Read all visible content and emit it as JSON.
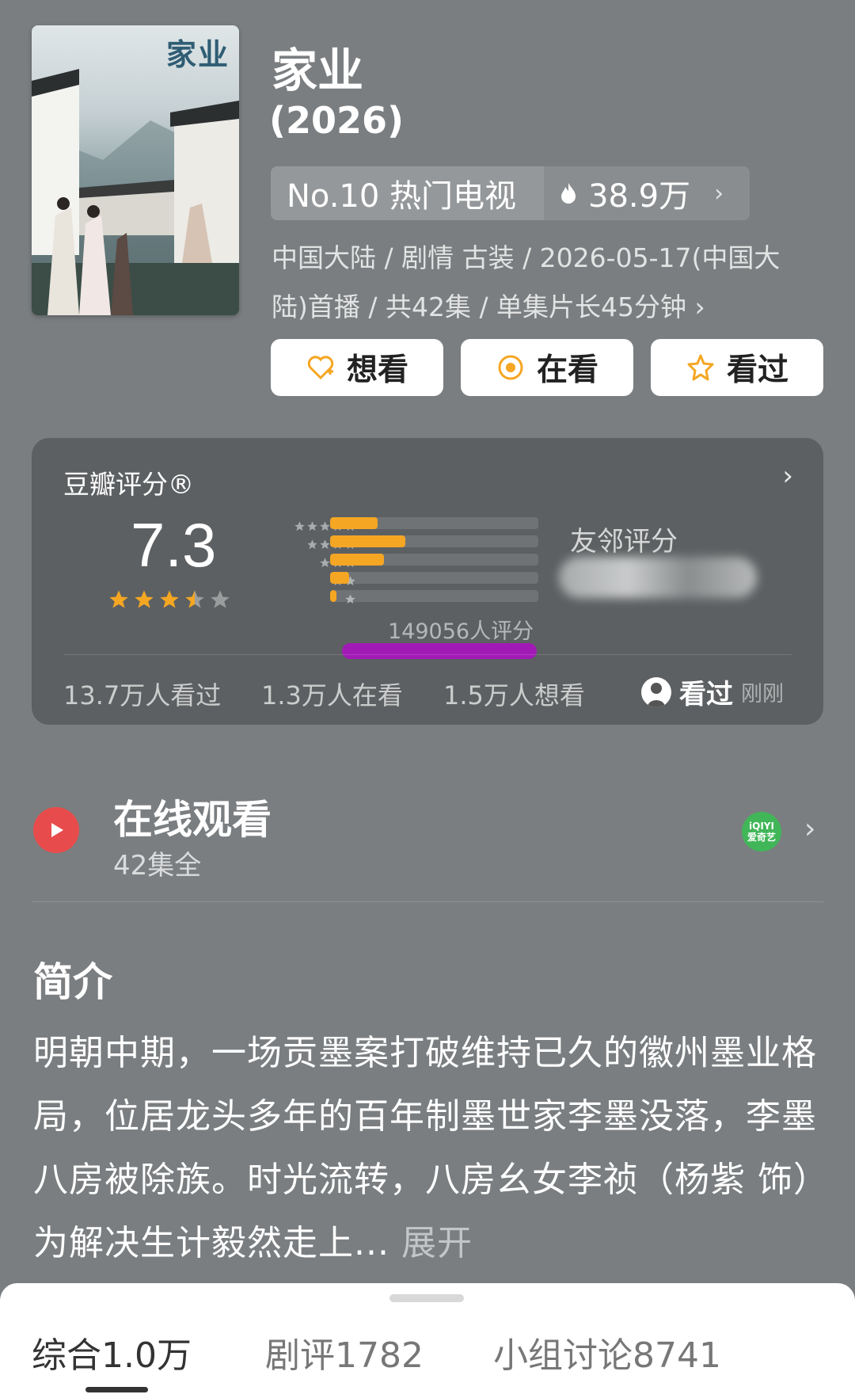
{
  "poster": {
    "title": "家业"
  },
  "header": {
    "title": "家业",
    "year": "(2026)",
    "rank_label": "No.10 热门电视",
    "heat_value": "38.9万",
    "meta_line1": "中国大陆 / 剧情 古装 / 2026-05-17(中国大",
    "meta_line2": "陆)首播 / 共42集 / 单集片长45分钟 ›"
  },
  "actions": [
    {
      "label": "想看",
      "icon": "heart-plus-icon"
    },
    {
      "label": "在看",
      "icon": "target-icon"
    },
    {
      "label": "看过",
      "icon": "star-outline-icon"
    }
  ],
  "rating": {
    "label": "豆瓣评分®",
    "score": "7.3",
    "stars": 3.5,
    "distribution": [
      {
        "stars": 5,
        "fraction": 0.23
      },
      {
        "stars": 4,
        "fraction": 0.36
      },
      {
        "stars": 3,
        "fraction": 0.26
      },
      {
        "stars": 2,
        "fraction": 0.09
      },
      {
        "stars": 1,
        "fraction": 0.03
      }
    ],
    "count_text": "149056人评分",
    "friend_label": "友邻评分",
    "stats": [
      "13.7万人看过",
      "1.3万人在看",
      "1.5万人想看"
    ],
    "my_status": "看过",
    "my_status_time": "刚刚"
  },
  "watch": {
    "title": "在线观看",
    "subtitle": "42集全",
    "provider_label_1": "iQIYI",
    "provider_label_2": "爱奇艺"
  },
  "intro": {
    "heading": "简介",
    "text": "明朝中期，一场贡墨案打破维持已久的徽州墨业格局，位居龙头多年的百年制墨世家李墨没落，李墨八房被除族。时光流转，八房幺女李祯（杨紫 饰）为解决生计毅然走上... ",
    "expand_label": "展开"
  },
  "tabs": [
    {
      "label": "综合",
      "count": "1.0万"
    },
    {
      "label": "剧评",
      "count": "1782"
    },
    {
      "label": "小组讨论",
      "count": "8741"
    }
  ],
  "colors": {
    "accent": "#f5a623",
    "play": "#e84b4b",
    "mark": "#a21ab6",
    "provider": "#41b658"
  }
}
